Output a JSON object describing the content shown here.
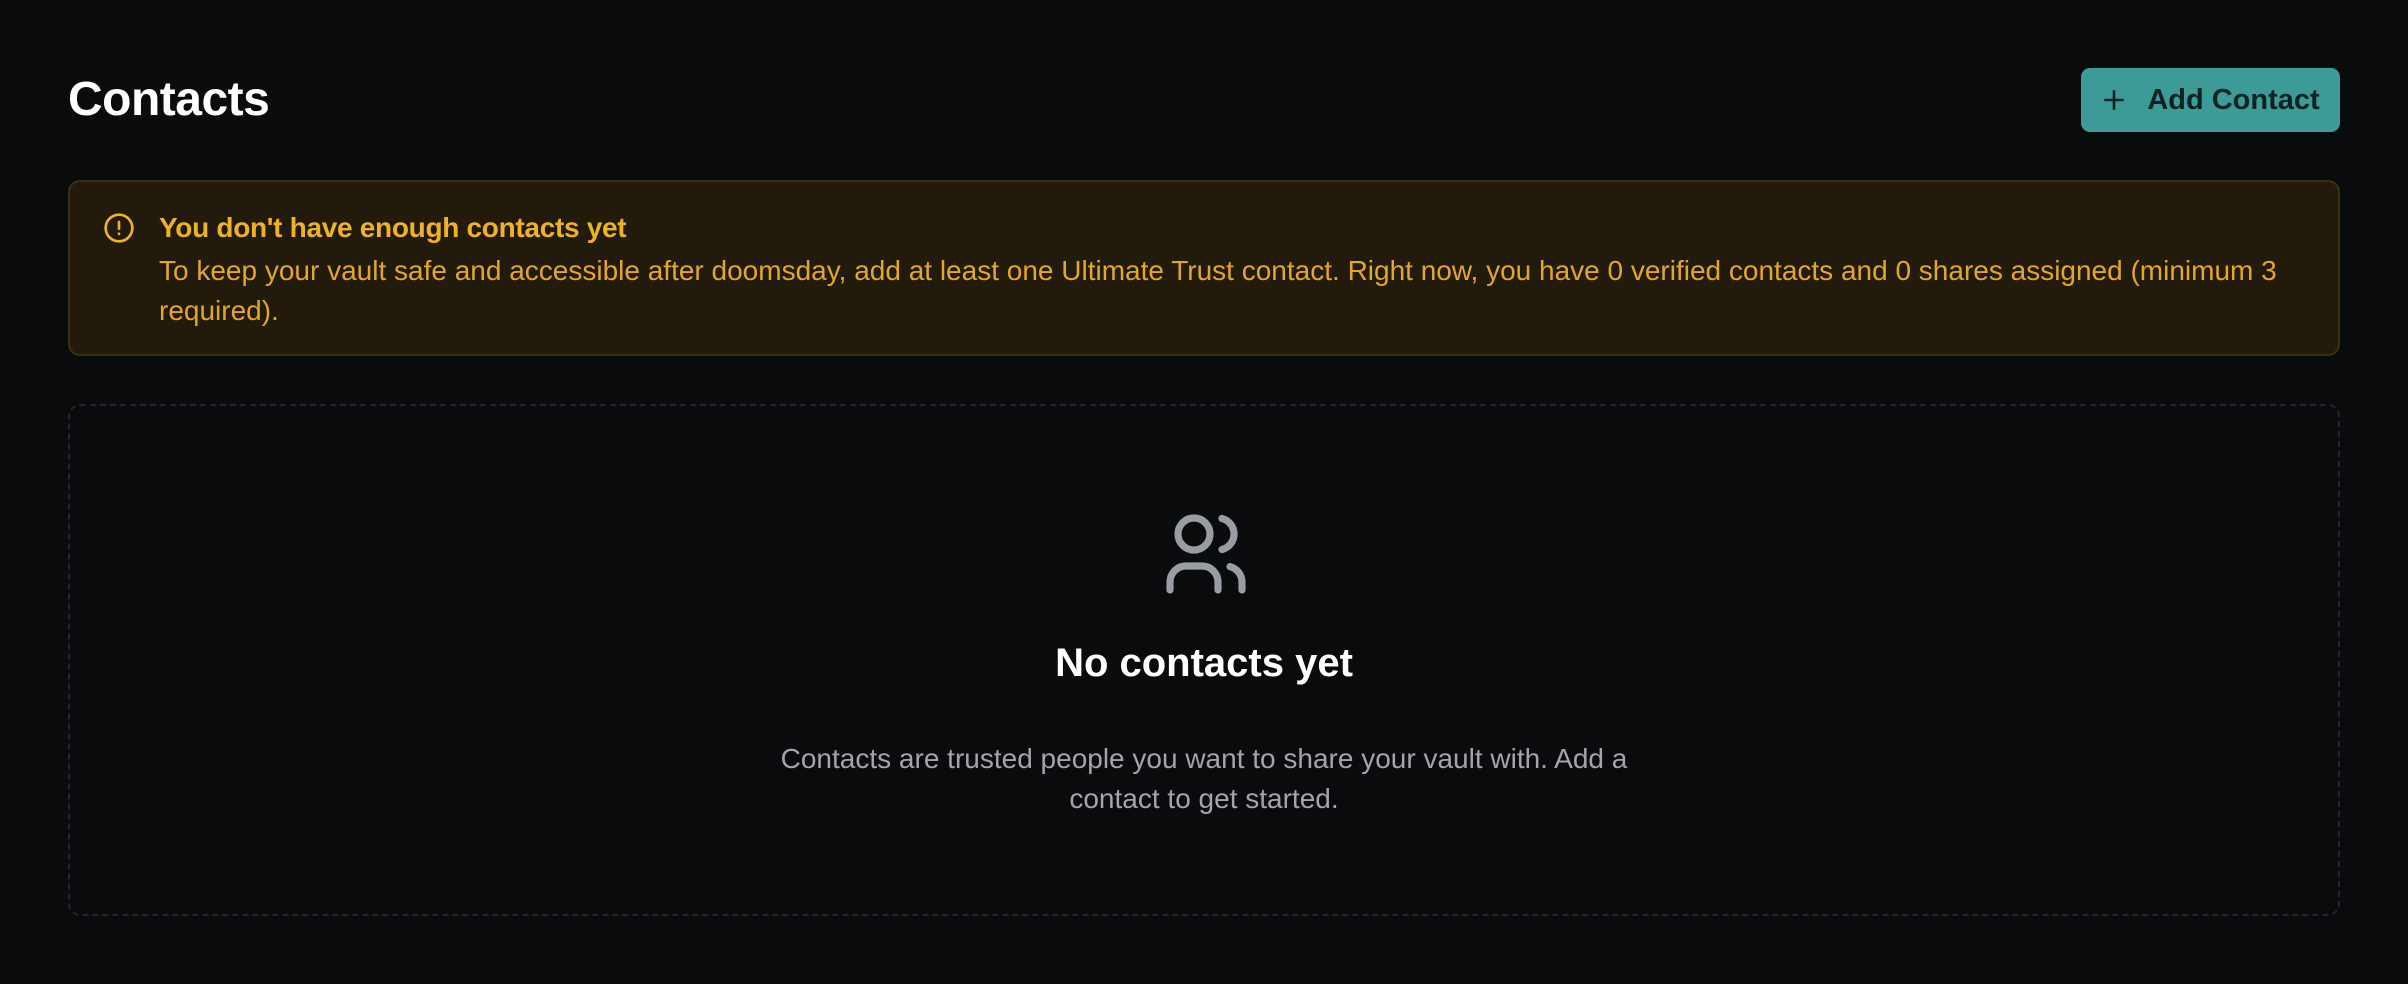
{
  "header": {
    "title": "Contacts",
    "add_button_label": "Add Contact",
    "add_button_icon": "plus-icon"
  },
  "warning": {
    "icon": "alert-circle-icon",
    "title": "You don't have enough contacts yet",
    "message": "To keep your vault safe and accessible after doomsday, add at least one Ultimate Trust contact. Right now, you have 0 verified contacts and 0 shares assigned (minimum 3 required)."
  },
  "empty_state": {
    "icon": "users-icon",
    "title": "No contacts yet",
    "description": "Contacts are trusted people you want to share your vault with. Add a contact to get started."
  },
  "colors": {
    "background": "#0a0b0d",
    "accent": "#3d9b97",
    "warning_background": "#221a0b",
    "warning_text": "#f0b225",
    "muted_text": "#a3a5ab"
  }
}
